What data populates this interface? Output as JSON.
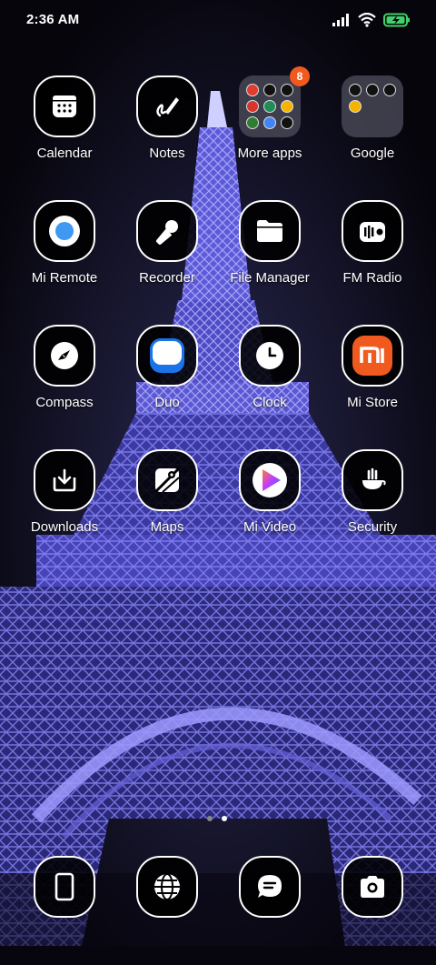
{
  "status_bar": {
    "time": "2:36 AM",
    "icons": [
      "signal-icon",
      "wifi-icon",
      "battery-charging-icon"
    ]
  },
  "home": {
    "apps": [
      {
        "label": "Calendar",
        "icon": "calendar-icon"
      },
      {
        "label": "Notes",
        "icon": "notes-icon"
      },
      {
        "label": "More apps",
        "icon": "folder-icon",
        "badge": "8"
      },
      {
        "label": "Google",
        "icon": "folder-icon"
      },
      {
        "label": "Mi Remote",
        "icon": "mi-remote-icon"
      },
      {
        "label": "Recorder",
        "icon": "microphone-icon"
      },
      {
        "label": "File Manager",
        "icon": "folder-file-icon"
      },
      {
        "label": "FM Radio",
        "icon": "radio-icon"
      },
      {
        "label": "Compass",
        "icon": "compass-icon"
      },
      {
        "label": "Duo",
        "icon": "duo-icon"
      },
      {
        "label": "Clock",
        "icon": "clock-icon"
      },
      {
        "label": "Mi Store",
        "icon": "mi-store-icon"
      },
      {
        "label": "Downloads",
        "icon": "download-icon"
      },
      {
        "label": "Maps",
        "icon": "maps-icon"
      },
      {
        "label": "Mi Video",
        "icon": "play-icon"
      },
      {
        "label": "Security",
        "icon": "security-icon"
      }
    ],
    "page_indicator": {
      "pages": 2,
      "current": 2
    }
  },
  "dock": {
    "apps": [
      {
        "icon": "phone-icon"
      },
      {
        "icon": "globe-icon"
      },
      {
        "icon": "message-icon"
      },
      {
        "icon": "camera-icon"
      }
    ]
  },
  "colors": {
    "accent_orange": "#f05a1e",
    "wallpaper_glow": "#8f8cff",
    "battery_green": "#41d16a",
    "duo_blue": "#1a73e8"
  }
}
